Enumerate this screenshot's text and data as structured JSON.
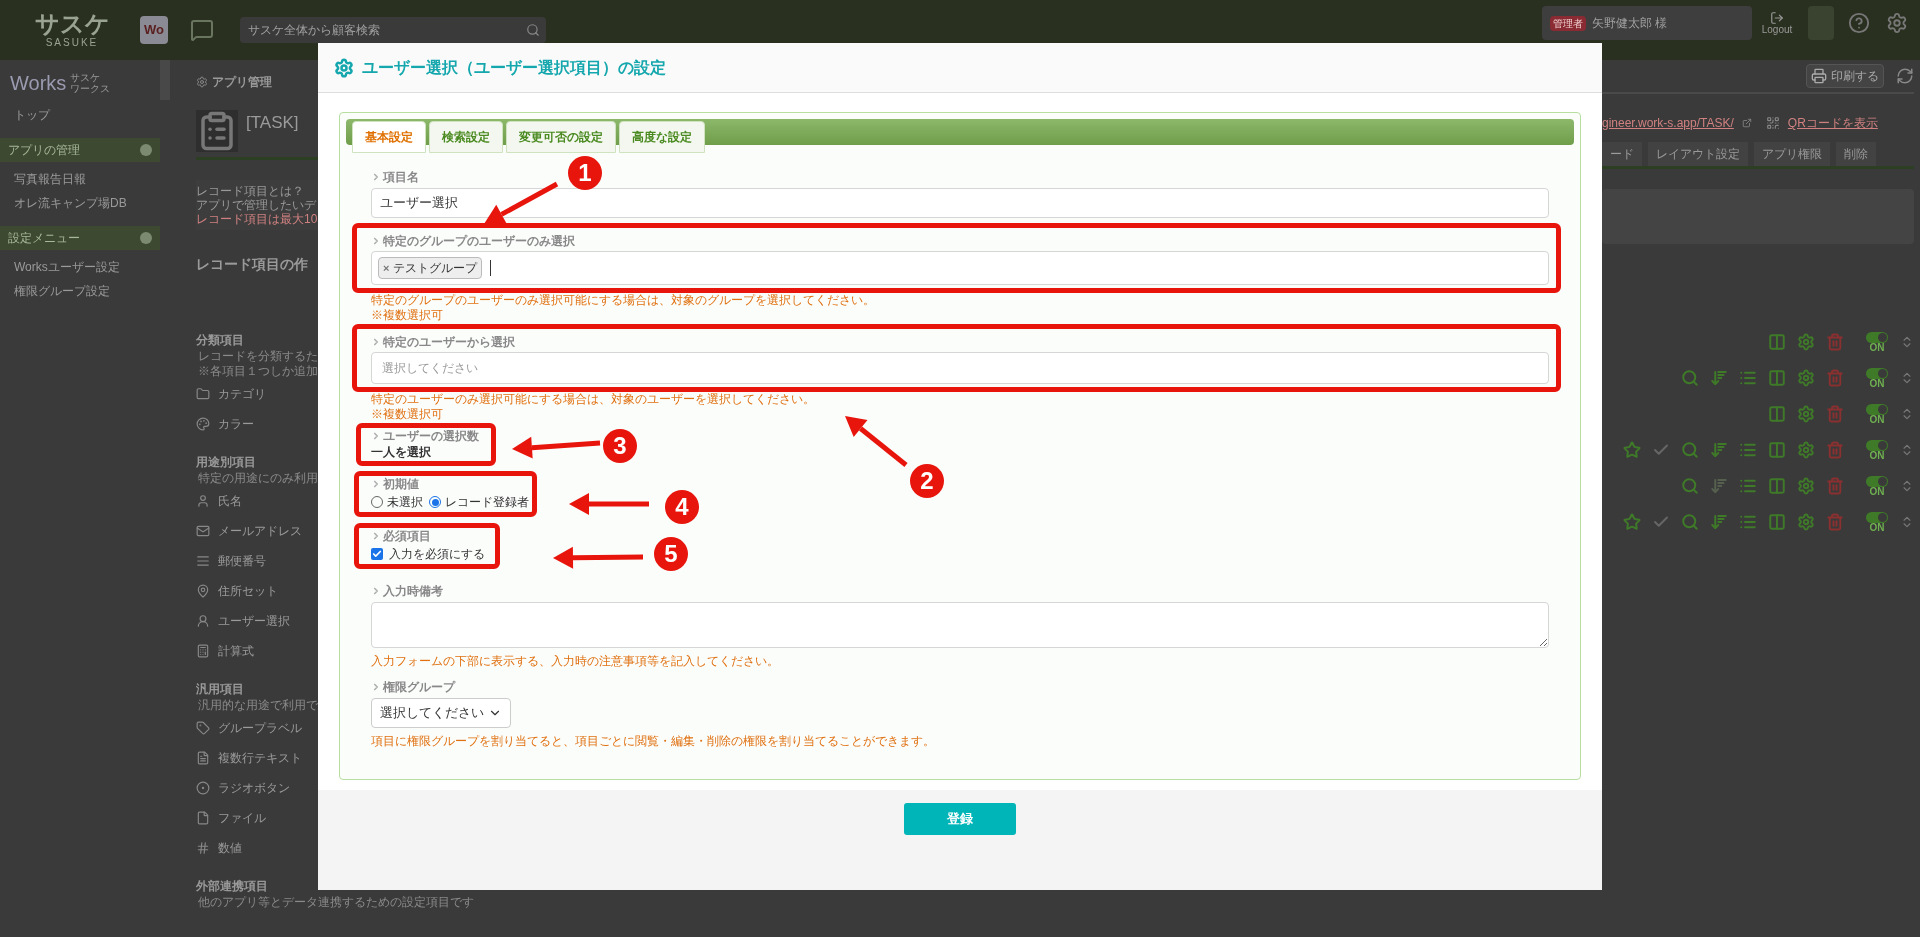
{
  "topbar": {
    "logo": "サスケ",
    "logo_sub": "SASUKE",
    "app_badge": "Wo",
    "search_placeholder": "サスケ全体から顧客検索",
    "role_badge": "管理者",
    "user": "矢野健太郎 様",
    "logout": "Logout"
  },
  "sidebar": {
    "logo": "Works",
    "logo_sub": [
      "サスケ",
      "ワークス"
    ],
    "top_link": "トップ",
    "sections": [
      {
        "title": "アプリの管理",
        "items": [
          "写真報告日報",
          "オレ流キャンプ場DB"
        ]
      },
      {
        "title": "設定メニュー",
        "items": [
          "Worksユーザー設定",
          "権限グループ設定"
        ]
      }
    ]
  },
  "main": {
    "header": "アプリ管理",
    "app_title": "[TASK]",
    "info": [
      "レコード項目とは？",
      "アプリで管理したいデ",
      "レコード項目は最大10"
    ],
    "section_title": "レコード項目の作",
    "groups": [
      {
        "title": "分類項目",
        "notes": [
          "レコードを分類するた",
          "※各項目１つしか追加"
        ],
        "items": [
          "カテゴリ",
          "カラー"
        ]
      },
      {
        "title": "用途別項目",
        "notes": [
          "特定の用途にのみ利用"
        ],
        "items": [
          "氏名",
          "メールアドレス",
          "郵便番号",
          "住所セット",
          "ユーザー選択",
          "計算式"
        ]
      },
      {
        "title": "汎用項目",
        "notes": [
          "汎用的な用途で利用で"
        ],
        "items": [
          "グループラベル",
          "複数行テキスト",
          "ラジオボタン",
          "ファイル",
          "数値"
        ]
      },
      {
        "title": "外部連携項目",
        "notes": [
          "他のアプリ等とデータ連携するための設定項目です"
        ]
      }
    ]
  },
  "right": {
    "print": "印刷する",
    "url": "gineer.work-s.app/TASK/",
    "qr": "QRコードを表示",
    "tabs": [
      "ード",
      "レイアウト設定",
      "アプリ権限",
      "削除"
    ],
    "rows": [
      {
        "kind": "basic",
        "toggle": "ON",
        "on": true
      },
      {
        "kind": "search",
        "toggle": "ON",
        "on": true
      },
      {
        "kind": "basic",
        "toggle": "ON",
        "on": true
      },
      {
        "kind": "full",
        "toggle": "ON",
        "on": true
      },
      {
        "kind": "search_dim",
        "toggle": "ON",
        "on": true
      },
      {
        "kind": "full",
        "toggle": "ON",
        "on": true
      }
    ]
  },
  "dialog": {
    "title": "ユーザー選択（ユーザー選択項目）の設定",
    "tabs": [
      {
        "label": "基本設定",
        "selected": true
      },
      {
        "label": "検索設定",
        "selected": false
      },
      {
        "label": "変更可否の設定",
        "selected": false
      },
      {
        "label": "高度な設定",
        "selected": false
      }
    ],
    "item_name": {
      "label": "項目名",
      "value": "ユーザー選択"
    },
    "group_filter": {
      "label": "特定のグループのユーザーのみ選択",
      "tag_remove": "×",
      "tags": [
        "テストグループ"
      ],
      "hints": [
        "特定のグループのユーザーのみ選択可能にする場合は、対象のグループを選択してください。",
        "※複数選択可"
      ]
    },
    "user_filter": {
      "label": "特定のユーザーから選択",
      "placeholder": "選択してください",
      "hints": [
        "特定のユーザーのみ選択可能にする場合は、対象のユーザーを選択してください。",
        "※複数選択可"
      ]
    },
    "selection_count": {
      "label": "ユーザーの選択数",
      "value": "一人を選択"
    },
    "default_value": {
      "label": "初期値",
      "options": [
        {
          "label": "未選択",
          "selected": false
        },
        {
          "label": "レコード登録者",
          "selected": true
        }
      ]
    },
    "required": {
      "label": "必須項目",
      "checkbox": {
        "label": "入力を必須にする",
        "checked": true
      }
    },
    "note": {
      "label": "入力時備考",
      "hint": "入力フォームの下部に表示する、入力時の注意事項等を記入してください。"
    },
    "permission_group": {
      "label": "権限グループ",
      "value": "選択してください",
      "hint": "項目に権限グループを割り当てると、項目ごとに閲覧・編集・削除の権限を割り当てることができます。"
    },
    "submit": "登録"
  },
  "annotations": [
    {
      "number": "1"
    },
    {
      "number": "2"
    },
    {
      "number": "3"
    },
    {
      "number": "4"
    },
    {
      "number": "5"
    }
  ]
}
